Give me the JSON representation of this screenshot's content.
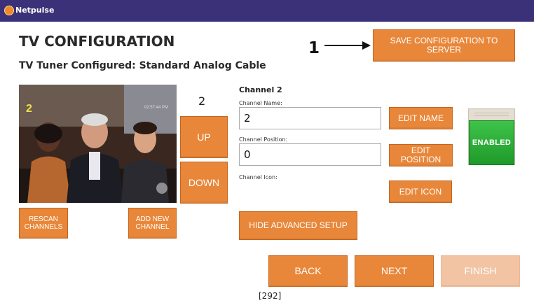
{
  "titlebar": {
    "app_name": "Netpulse"
  },
  "page": {
    "title": "TV CONFIGURATION",
    "subtitle": "TV Tuner Configured: Standard Analog Cable"
  },
  "annotation": {
    "number": "1"
  },
  "save_button": "SAVE CONFIGURATION TO SERVER",
  "preview": {
    "channel_overlay": "2",
    "time_overlay": "02:57:44 PM"
  },
  "channel_number": "2",
  "nav": {
    "up": "UP",
    "down": "DOWN"
  },
  "left_buttons": {
    "rescan": "RESCAN CHANNELS",
    "add_new": "ADD NEW CHANNEL"
  },
  "channel_panel": {
    "heading": "Channel 2",
    "name_label": "Channel Name:",
    "name_value": "2",
    "position_label": "Channel Position:",
    "position_value": "0",
    "icon_label": "Channel Icon:"
  },
  "edit_buttons": {
    "name": "EDIT NAME",
    "position": "EDIT POSITION",
    "icon": "EDIT ICON"
  },
  "status_toggle": {
    "label": "ENABLED",
    "color": "#2fae3a"
  },
  "advanced_button": "HIDE ADVANCED SETUP",
  "footer_buttons": {
    "back": "BACK",
    "next": "NEXT",
    "finish": "FINISH"
  },
  "footer_count": "[292]",
  "colors": {
    "titlebar": "#3a3179",
    "accent": "#e8873a",
    "disabled": "#f2c4a4"
  }
}
